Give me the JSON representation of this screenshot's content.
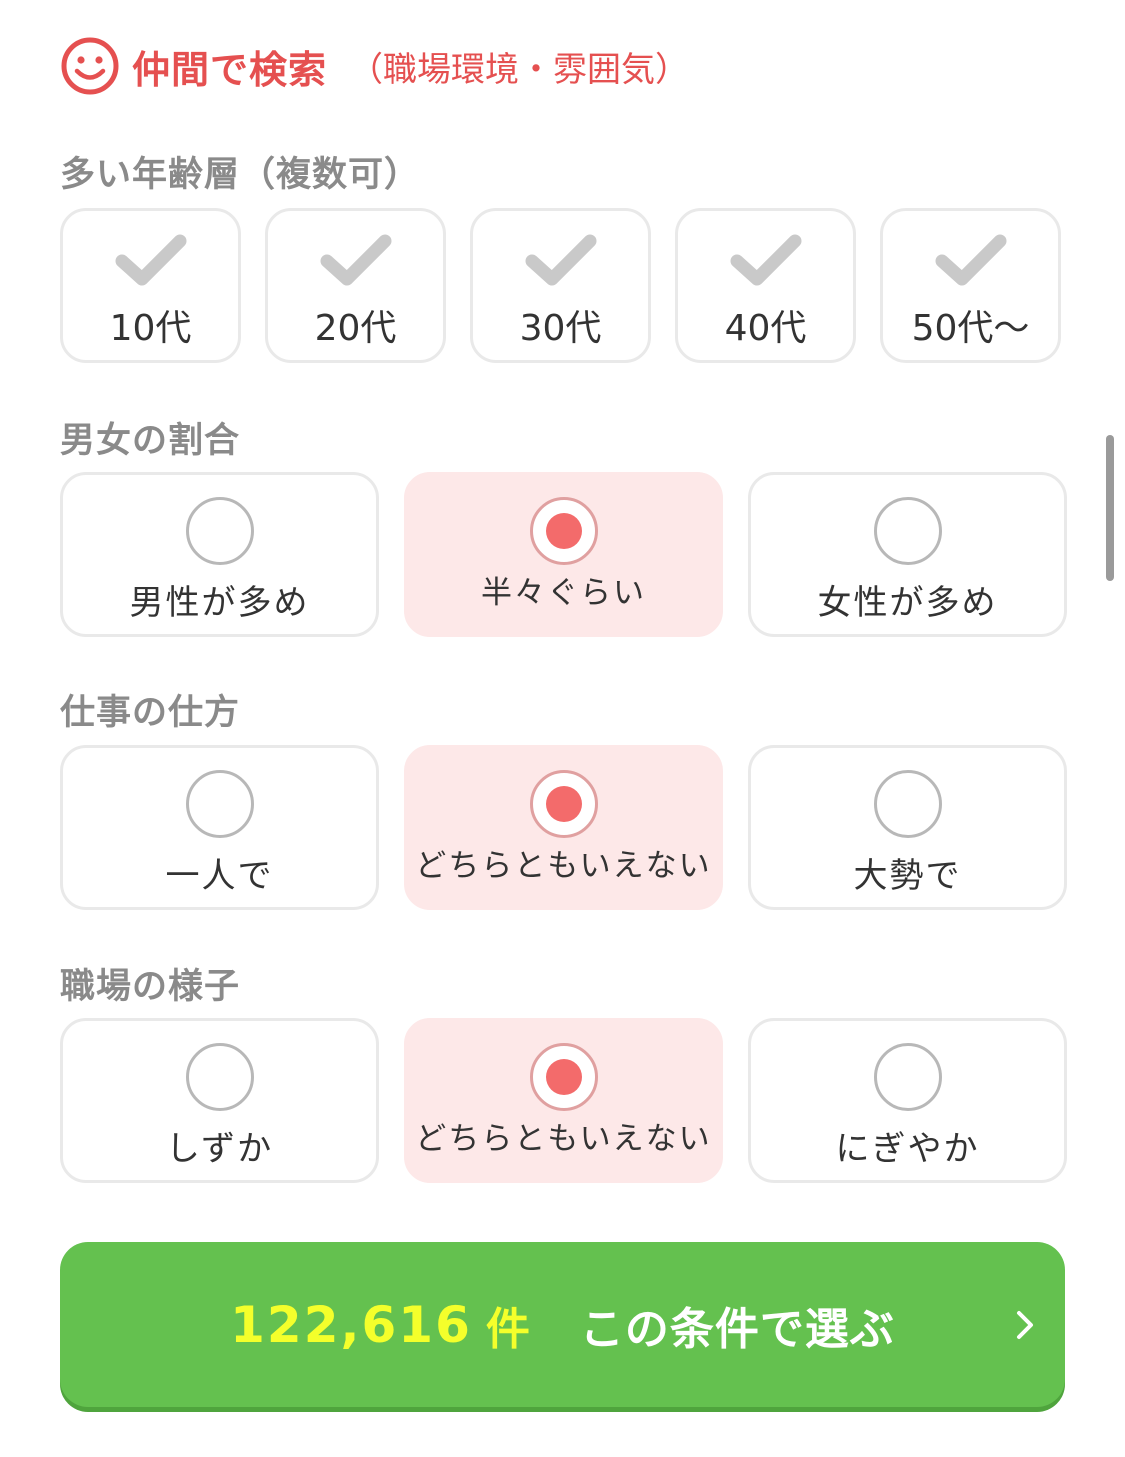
{
  "header": {
    "title": "仲間で検索",
    "subtitle": "（職場環境・雰囲気）",
    "icon": "smiley-icon",
    "accent_color": "#e55050"
  },
  "age_section": {
    "label": "多い年齢層（複数可）",
    "options": [
      {
        "label": "10代",
        "checked": false
      },
      {
        "label": "20代",
        "checked": false
      },
      {
        "label": "30代",
        "checked": false
      },
      {
        "label": "40代",
        "checked": false
      },
      {
        "label": "50代〜",
        "checked": false
      }
    ]
  },
  "gender_section": {
    "label": "男女の割合",
    "options": [
      {
        "label": "男性が多め",
        "selected": false
      },
      {
        "label": "半々ぐらい",
        "selected": true
      },
      {
        "label": "女性が多め",
        "selected": false
      }
    ]
  },
  "work_section": {
    "label": "仕事の仕方",
    "options": [
      {
        "label": "一人で",
        "selected": false
      },
      {
        "label": "どちらともいえない",
        "selected": true
      },
      {
        "label": "大勢で",
        "selected": false
      }
    ]
  },
  "atmosphere_section": {
    "label": "職場の様子",
    "options": [
      {
        "label": "しずか",
        "selected": false
      },
      {
        "label": "どちらともいえない",
        "selected": true
      },
      {
        "label": "にぎやか",
        "selected": false
      }
    ]
  },
  "submit": {
    "count": "122,616",
    "unit": "件",
    "label": "この条件で選ぶ",
    "icon": "chevron-right-icon",
    "color": "#64c14f",
    "count_color": "#f4ff2b"
  },
  "colors": {
    "selected_bg": "#fde8e8",
    "radio_dot": "#f36b6b",
    "check_gray": "#c9c9c9",
    "section_label": "#8a8a8a"
  }
}
